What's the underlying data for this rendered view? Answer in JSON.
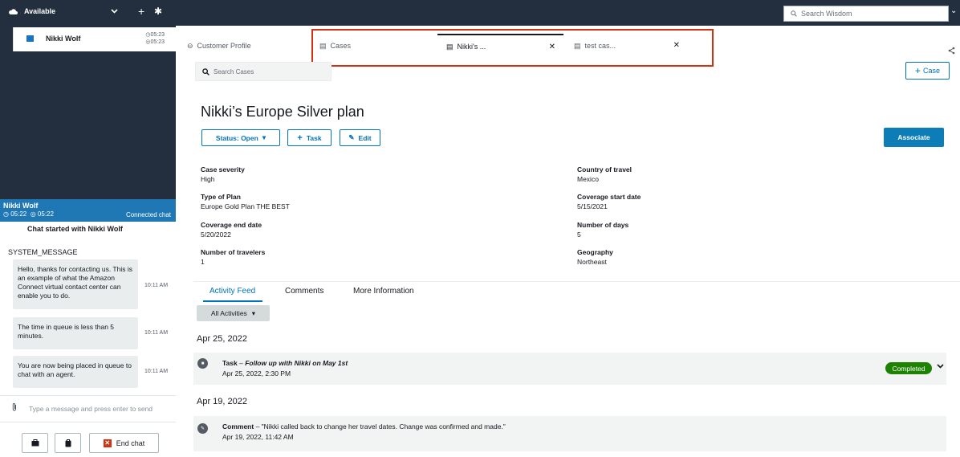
{
  "topbar": {
    "status": "Available",
    "search_placeholder": "Search Wisdom"
  },
  "contact": {
    "name": "Nikki Wolf",
    "time1": "05:23",
    "time2": "05:23"
  },
  "chat": {
    "header_name": "Nikki Wolf",
    "header_time1": "05:22",
    "header_time2": "05:22",
    "header_status": "Connected chat",
    "started": "Chat started with  Nikki Wolf",
    "system_label": "SYSTEM_MESSAGE",
    "messages": [
      {
        "text": "Hello, thanks for contacting us. This is an example of what the Amazon Connect virtual contact center can enable you to do.",
        "time": "10:11 AM"
      },
      {
        "text": "The time in queue is less than 5 minutes.",
        "time": "10:11 AM"
      },
      {
        "text": "You are now being placed in queue to chat with an agent.",
        "time": "10:11 AM"
      }
    ],
    "composer_placeholder": "Type a message and press enter to send",
    "end_label": "End chat"
  },
  "tabs": {
    "customer_profile": "Customer Profile",
    "cases": "Cases",
    "nikkis": "Nikki's ...",
    "testcas": "test cas..."
  },
  "search_cases": "Search Cases",
  "add_case": "Case",
  "case": {
    "title": "Nikki’s Europe Silver plan",
    "status_btn": "Status: Open",
    "task_btn": "Task",
    "edit_btn": "Edit",
    "associate": "Associate",
    "left_fields": [
      {
        "k": "Case severity",
        "v": "High"
      },
      {
        "k": "Type of Plan",
        "v": "Europe Gold Plan THE BEST"
      },
      {
        "k": "Coverage end date",
        "v": "5/20/2022"
      },
      {
        "k": "Number of travelers",
        "v": "1"
      }
    ],
    "right_fields": [
      {
        "k": "Country of travel",
        "v": "Mexico"
      },
      {
        "k": "Coverage start date",
        "v": "5/15/2021"
      },
      {
        "k": "Number of days",
        "v": "5"
      },
      {
        "k": "Geography",
        "v": "Northeast"
      }
    ]
  },
  "feed_tabs": [
    "Activity Feed",
    "Comments",
    "More Information"
  ],
  "filter": "All Activities",
  "activity": {
    "date1": "Apr 25, 2022",
    "item1_type": "Task",
    "item1_title": "Follow up with Nikki on May 1st",
    "item1_time": "Apr 25, 2022, 2:30 PM",
    "item1_status": "Completed",
    "date2": "Apr 19, 2022",
    "item2_type": "Comment",
    "item2_text": "\"Nikki called back to change her travel dates. Change was confirmed and made.\"",
    "item2_time": "Apr 19, 2022, 11:42 AM"
  },
  "colors": {
    "accent": "#0073bb",
    "success": "#1d8102",
    "danger": "#d13212",
    "nav": "#232f3e"
  }
}
